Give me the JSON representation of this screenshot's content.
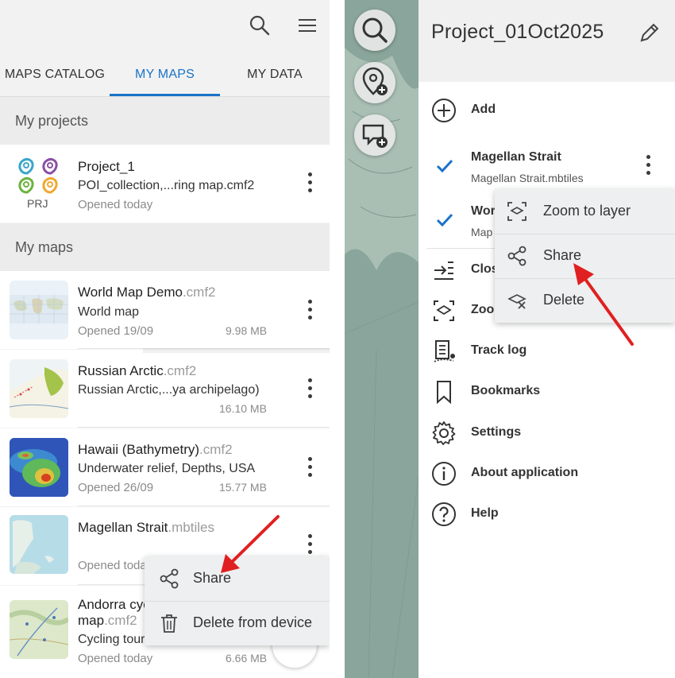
{
  "left_panel": {
    "tabs": [
      {
        "label": "MAPS CATALOG"
      },
      {
        "label": "MY MAPS"
      },
      {
        "label": "MY DATA"
      }
    ],
    "active_tab": "MY MAPS",
    "my_projects_header": "My projects",
    "my_maps_header": "My maps",
    "project": {
      "name": "Project_1",
      "files": "POI_collection,...ring map.cmf2",
      "opened": "Opened today",
      "badge": "PRJ"
    },
    "maps": [
      {
        "name": "World Map Demo",
        "ext": ".cmf2",
        "description": "World map",
        "opened": "Opened 19/09",
        "size": "9.98 MB"
      },
      {
        "name": "Russian Arctic",
        "ext": ".cmf2",
        "description": "Russian Arctic,...ya archipelago)",
        "opened": "",
        "size": "16.10 MB"
      },
      {
        "name": "Hawaii (Bathymetry)",
        "ext": ".cmf2",
        "description": "Underwater relief, Depths, USA",
        "opened": "Opened 26/09",
        "size": "15.77 MB"
      },
      {
        "name": "Magellan Strait",
        "ext": ".mbtiles",
        "description": "",
        "opened": "Opened toda",
        "size": ""
      },
      {
        "name": "Andorra cyc",
        "name_line2": "map",
        "ext": ".cmf2",
        "description": "Cycling tour",
        "opened": "Opened today",
        "size": "6.66 MB"
      }
    ],
    "context_menu": {
      "items": [
        {
          "label": "Share",
          "icon": "share-icon"
        },
        {
          "label": "Delete from device",
          "icon": "trash-icon"
        }
      ]
    }
  },
  "right_panel": {
    "project_title": "Project_01Oct2025",
    "menu": {
      "add": "Add",
      "close": "Clos",
      "zoom": "Zoo",
      "track_log": "Track log",
      "bookmarks": "Bookmarks",
      "settings": "Settings",
      "about": "About application",
      "help": "Help"
    },
    "layers": [
      {
        "name": "Magellan Strait",
        "file": "Magellan Strait.mbtiles",
        "checked": true
      },
      {
        "name": "Wor",
        "file": "Map",
        "checked": true
      }
    ],
    "layer_context_menu": {
      "items": [
        {
          "label": "Zoom to layer",
          "icon": "zoom-to-layer-icon"
        },
        {
          "label": "Share",
          "icon": "share-icon"
        },
        {
          "label": "Delete",
          "icon": "delete-layer-icon"
        }
      ]
    }
  },
  "colors": {
    "accent": "#1a73c8",
    "check": "#1a73c8",
    "annotation_arrow": "#e02020"
  }
}
